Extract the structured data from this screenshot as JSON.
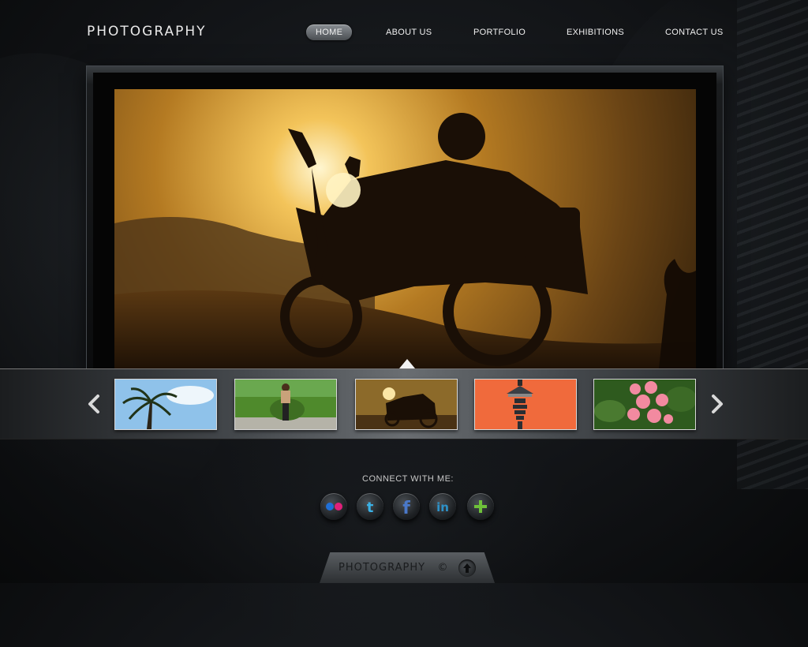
{
  "site": {
    "logo": "PHOTOGRAPHY"
  },
  "nav": {
    "items": [
      {
        "label": "HOME",
        "active": true
      },
      {
        "label": "ABOUT US",
        "active": false
      },
      {
        "label": "PORTFOLIO",
        "active": false
      },
      {
        "label": "EXHIBITIONS",
        "active": false
      },
      {
        "label": "CONTACT US",
        "active": false
      }
    ]
  },
  "slider": {
    "thumbnails": [
      {
        "subject": "palm tree",
        "selected": false
      },
      {
        "subject": "motorcycle rider with grass",
        "selected": false
      },
      {
        "subject": "motorcycle at sunset",
        "selected": true
      },
      {
        "subject": "street lamp",
        "selected": false
      },
      {
        "subject": "pink flowers",
        "selected": false
      }
    ],
    "prev_icon": "chevron-left-icon",
    "next_icon": "chevron-right-icon"
  },
  "connect": {
    "heading": "CONNECT WITH ME:",
    "icons": [
      "flickr-icon",
      "twitter-icon",
      "facebook-icon",
      "linkedin-icon",
      "plus-icon"
    ]
  },
  "footer": {
    "text": "PHOTOGRAPHY",
    "copyright_symbol": "©",
    "up_icon": "arrow-up-icon"
  },
  "colors": {
    "background": "#121417",
    "accent_flickr_blue": "#1f6fd6",
    "accent_flickr_pink": "#e0207a",
    "accent_twitter": "#3ab1e6",
    "accent_facebook": "#4a78c8",
    "accent_linkedin": "#2d91c8",
    "accent_plus": "#6ec03a"
  }
}
